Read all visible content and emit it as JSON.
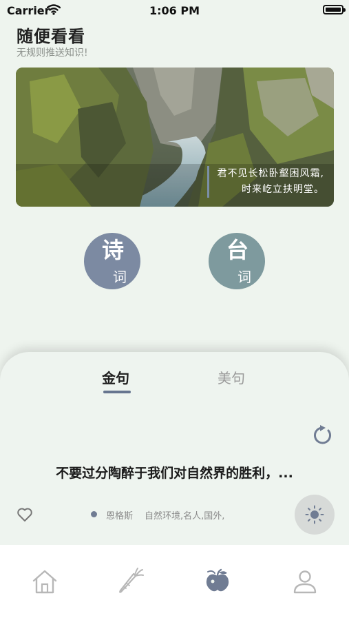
{
  "status_bar": {
    "carrier": "Carrier",
    "time": "1:06 PM"
  },
  "header": {
    "title": "随便看看",
    "subtitle": "无规则推送知识!"
  },
  "banner": {
    "quote_line1": "君不见长松卧壑困风霜,",
    "quote_line2": "时来屹立扶明堂。"
  },
  "categories": [
    {
      "big": "诗",
      "small": "词",
      "color": "#7c8aa2"
    },
    {
      "big": "台",
      "small": "词",
      "color": "#7e9a9e"
    }
  ],
  "tabs": [
    {
      "label": "金句",
      "active": true
    },
    {
      "label": "美句",
      "active": false
    }
  ],
  "card": {
    "sentence": "不要过分陶醉于我们对自然界的胜利，...",
    "author": "恩格斯",
    "tags": "自然环境,名人,国外,"
  },
  "tab_bar": {
    "items": [
      "home-icon",
      "carrot-icon",
      "fruit-icon",
      "profile-icon"
    ],
    "active_index": 2
  },
  "colors": {
    "accent": "#66758f",
    "background": "#eef4ee"
  }
}
